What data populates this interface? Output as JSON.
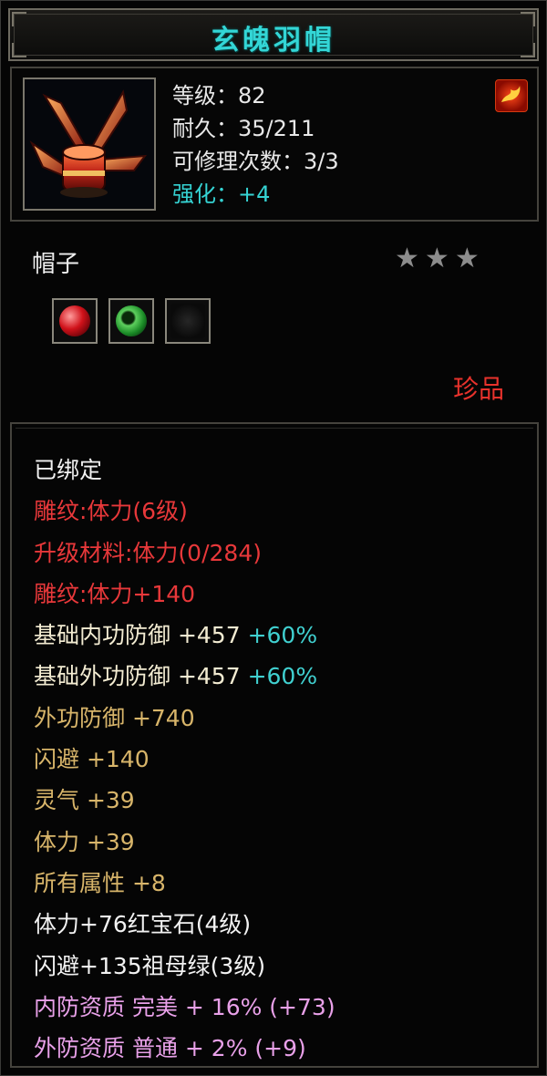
{
  "title": "玄魄羽帽",
  "header": {
    "level": "等级：82",
    "durability": "耐久：35/211",
    "repairs": "可修理次数：3/3",
    "enhance": "强化：+4",
    "item_icon": "feathered-hat-icon",
    "badge_icon": "phoenix-badge-icon"
  },
  "item_type": "帽子",
  "stars": [
    "★",
    "★",
    "★"
  ],
  "sockets": [
    {
      "gem": "red-ruby-gem-icon"
    },
    {
      "gem": "green-emerald-gem-icon"
    },
    {
      "gem": "empty-socket-icon"
    }
  ],
  "rarity": "珍品",
  "attributes": [
    {
      "text": "已绑定",
      "pct": "",
      "color": "#f2f2f2"
    },
    {
      "text": "雕纹:体力(6级)",
      "pct": "",
      "color": "#e8383a"
    },
    {
      "text": "升级材料:体力(0/284)",
      "pct": "",
      "color": "#e8383a"
    },
    {
      "text": "雕纹:体力+140",
      "pct": "",
      "color": "#e8383a"
    },
    {
      "text": "基础内功防御  +457",
      "pct": "+60%",
      "color": "#f3ecd2"
    },
    {
      "text": "基础外功防御  +457",
      "pct": "+60%",
      "color": "#f3ecd2"
    },
    {
      "text": "外功防御  +740",
      "pct": "",
      "color": "#d8b56a"
    },
    {
      "text": "闪避  +140",
      "pct": "",
      "color": "#d8b56a"
    },
    {
      "text": "灵气  +39",
      "pct": "",
      "color": "#d8b56a"
    },
    {
      "text": "体力  +39",
      "pct": "",
      "color": "#d8b56a"
    },
    {
      "text": "所有属性  +8",
      "pct": "",
      "color": "#d8b56a"
    },
    {
      "text": "体力+76红宝石(4级)",
      "pct": "",
      "color": "#f2f2f2"
    },
    {
      "text": "闪避+135祖母绿(3级)",
      "pct": "",
      "color": "#f2f2f2"
    },
    {
      "text": "内防资质  完美  +  16% (+73)",
      "pct": "",
      "color": "#e8a0e8"
    },
    {
      "text": "外防资质  普通  +  2% (+9)",
      "pct": "",
      "color": "#e8a0e8"
    }
  ],
  "colors": {
    "title": "#33d6d6",
    "rarity": "#e8322c",
    "percent": "#40d0d0"
  }
}
